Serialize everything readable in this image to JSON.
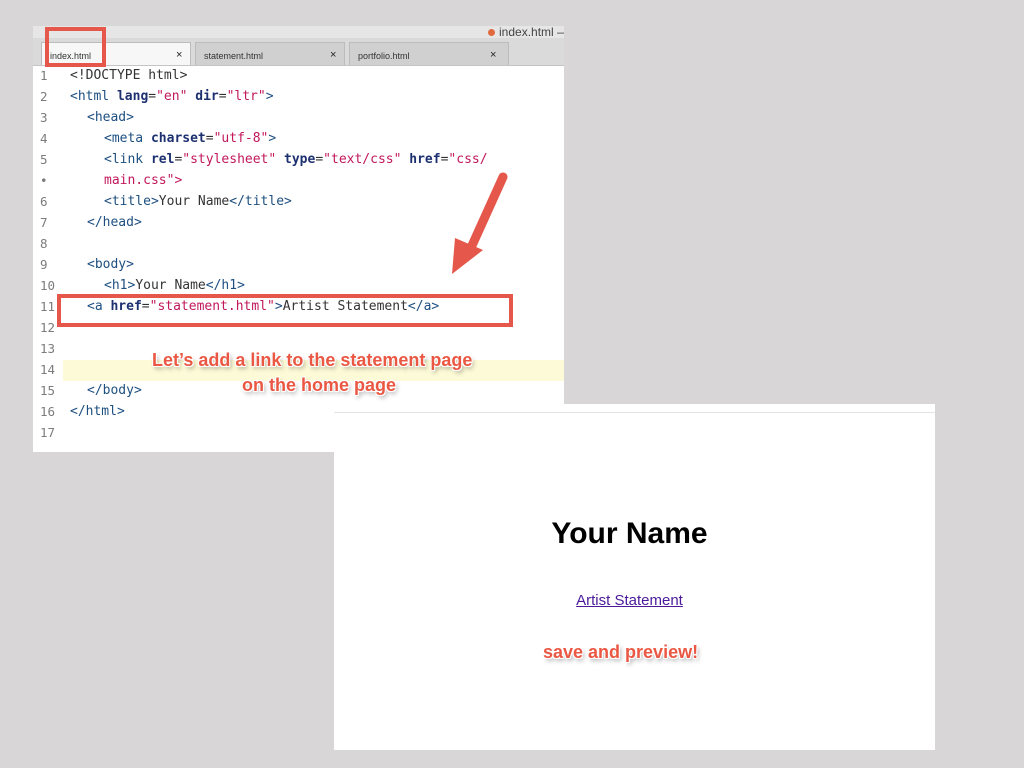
{
  "window": {
    "title": "index.html — ..."
  },
  "tabs": [
    {
      "label": "index.html",
      "close": "×",
      "active": true
    },
    {
      "label": "statement.html",
      "close": "×",
      "active": false
    },
    {
      "label": "portfolio.html",
      "close": "×",
      "active": false
    }
  ],
  "gutter": [
    "1",
    "2",
    "3",
    "4",
    "5",
    "•",
    "6",
    "7",
    "8",
    "9",
    "10",
    "11",
    "12",
    "13",
    "14",
    "15",
    "16",
    "17"
  ],
  "code": {
    "l1": {
      "open": "<!DOCTYPE html>"
    },
    "l2": {
      "t1": "<",
      "tag": "html",
      "sp1": " ",
      "a1": "lang",
      "eq1": "=",
      "v1": "\"en\"",
      "sp2": " ",
      "a2": "dir",
      "eq2": "=",
      "v2": "\"ltr\"",
      "close": ">"
    },
    "l3": {
      "lt": "<",
      "tag": "head",
      "gt": ">"
    },
    "l4": {
      "lt": "<",
      "tag": "meta",
      "sp": " ",
      "a": "charset",
      "eq": "=",
      "v": "\"utf-8\"",
      "gt": ">"
    },
    "l5": {
      "lt": "<",
      "tag": "link",
      "sp1": " ",
      "a1": "rel",
      "eq1": "=",
      "v1": "\"stylesheet\"",
      "sp2": " ",
      "a2": "type",
      "eq2": "=",
      "v2": "\"text/css\"",
      "sp3": " ",
      "a3": "href",
      "eq3": "=",
      "v3": "\"css/"
    },
    "l5b": {
      "v": "main.css",
      "q": "\">"
    },
    "l6": {
      "lt": "<",
      "tag": "title",
      "gt": ">",
      "text": "Your Name",
      "lt2": "</",
      "tag2": "title",
      "gt2": ">"
    },
    "l7": {
      "lt": "</",
      "tag": "head",
      "gt": ">"
    },
    "l9": {
      "lt": "<",
      "tag": "body",
      "gt": ">"
    },
    "l10": {
      "lt": "<",
      "tag": "h1",
      "gt": ">",
      "text": "Your Name",
      "lt2": "</",
      "tag2": "h1",
      "gt2": ">"
    },
    "l11": {
      "lt": "<",
      "tag": "a",
      "sp": " ",
      "a": "href",
      "eq": "=",
      "v": "\"statement.html\"",
      "gt": ">",
      "text": "Artist Statement",
      "lt2": "</",
      "tag2": "a",
      "gt2": ">"
    },
    "l15": {
      "lt": "</",
      "tag": "body",
      "gt": ">"
    },
    "l16": {
      "lt": "</",
      "tag": "html",
      "gt": ">"
    }
  },
  "callouts": {
    "add_link_line1": "Let’s add a link to the statement page",
    "add_link_line2": "on the home page",
    "save_preview": "save and preview!"
  },
  "preview": {
    "heading": "Your Name",
    "link": "Artist Statement"
  },
  "colors": {
    "accent": "#e5574a",
    "tag": "#1d4f80",
    "attribute": "#1d3070",
    "string": "#c2185b",
    "link_visited": "#4b1a9b",
    "line_highlight": "#fdfbd7"
  }
}
